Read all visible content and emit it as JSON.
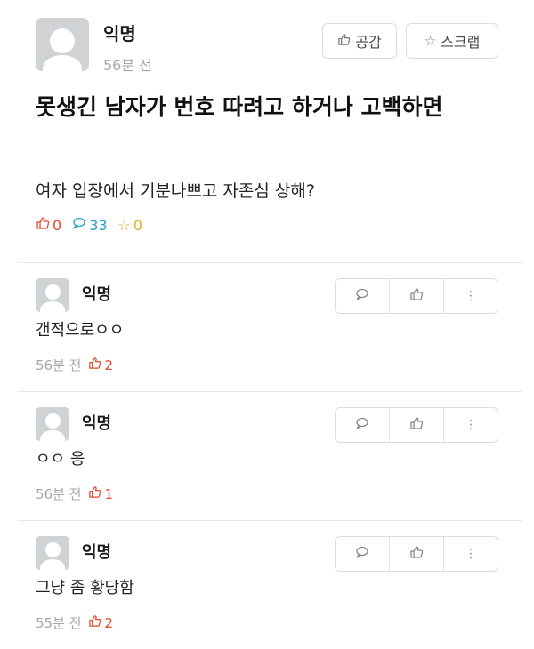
{
  "post": {
    "author": "익명",
    "time": "56분 전",
    "like_label": "공감",
    "scrap_label": "스크랩",
    "title": "못생긴 남자가 번호 따려고 하거나 고백하면",
    "content": "여자 입장에서 기분나쁘고 자존심 상해?",
    "stats": {
      "likes": "0",
      "comments": "33",
      "scraps": "0"
    }
  },
  "comments": [
    {
      "author": "익명",
      "text": "갠적으로ㅇㅇ",
      "time": "56분 전",
      "likes": "2"
    },
    {
      "author": "익명",
      "text": "ㅇㅇ 응",
      "time": "56분 전",
      "likes": "1"
    },
    {
      "author": "익명",
      "text": "그냥 좀 황당함",
      "time": "55분 전",
      "likes": "2"
    }
  ],
  "icons": {
    "thumbs_up": "thumbs-up-icon",
    "star": "star-icon",
    "speech": "speech-bubble-icon",
    "more": "more-vertical-icon"
  },
  "colors": {
    "like": "#e4472c",
    "comment": "#24a2c9",
    "scrap": "#d7b12b",
    "muted": "#a8a8a8"
  }
}
